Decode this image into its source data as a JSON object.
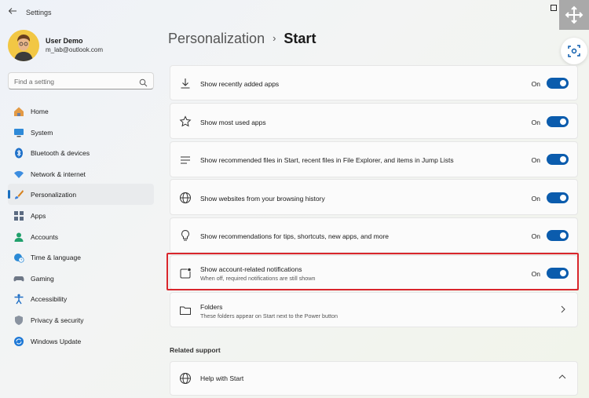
{
  "window": {
    "title": "Settings"
  },
  "user": {
    "name": "User Demo",
    "email": "m_lab@outlook.com"
  },
  "search": {
    "placeholder": "Find a setting"
  },
  "nav": [
    {
      "label": "Home",
      "icon": "home-icon"
    },
    {
      "label": "System",
      "icon": "system-icon"
    },
    {
      "label": "Bluetooth & devices",
      "icon": "bluetooth-icon"
    },
    {
      "label": "Network & internet",
      "icon": "wifi-icon"
    },
    {
      "label": "Personalization",
      "icon": "brush-icon",
      "active": true
    },
    {
      "label": "Apps",
      "icon": "apps-icon"
    },
    {
      "label": "Accounts",
      "icon": "accounts-icon"
    },
    {
      "label": "Time & language",
      "icon": "globe-clock-icon"
    },
    {
      "label": "Gaming",
      "icon": "gamepad-icon"
    },
    {
      "label": "Accessibility",
      "icon": "accessibility-icon"
    },
    {
      "label": "Privacy & security",
      "icon": "shield-icon"
    },
    {
      "label": "Windows Update",
      "icon": "update-icon"
    }
  ],
  "breadcrumb": {
    "parent": "Personalization",
    "separator": "›",
    "current": "Start"
  },
  "settings": [
    {
      "title": "Show recently added apps",
      "state": "On",
      "icon": "download-icon"
    },
    {
      "title": "Show most used apps",
      "state": "On",
      "icon": "star-icon"
    },
    {
      "title": "Show recommended files in Start, recent files in File Explorer, and items in Jump Lists",
      "state": "On",
      "icon": "list-icon"
    },
    {
      "title": "Show websites from your browsing history",
      "state": "On",
      "icon": "globe-icon"
    },
    {
      "title": "Show recommendations for tips, shortcuts, new apps, and more",
      "state": "On",
      "icon": "lightbulb-icon"
    },
    {
      "title": "Show account-related notifications",
      "subtitle": "When off, required notifications are still shown",
      "state": "On",
      "icon": "notification-icon"
    }
  ],
  "folders": {
    "title": "Folders",
    "subtitle": "These folders appear on Start next to the Power button"
  },
  "related_support": {
    "heading": "Related support",
    "help_title": "Help with Start"
  },
  "colors": {
    "accent": "#0b5cad",
    "highlight_border": "#d9262c"
  }
}
